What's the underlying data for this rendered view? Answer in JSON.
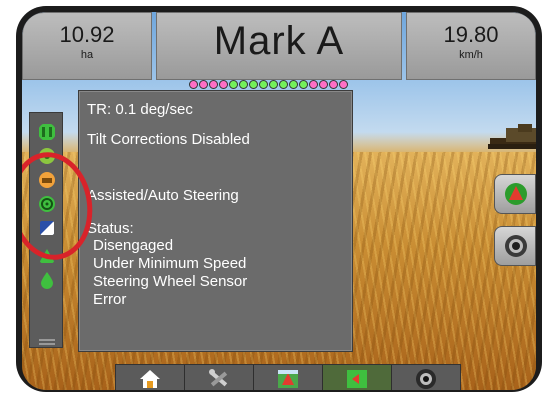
{
  "area": {
    "value": "10.92",
    "unit": "ha"
  },
  "mark": {
    "label": "Mark A"
  },
  "speed": {
    "value": "19.80",
    "unit": "km/h"
  },
  "lightbar": {
    "pink_dots": 4,
    "green_dots": 8,
    "pink_dots_right": 4
  },
  "panel": {
    "tr": "TR: 0.1 deg/sec",
    "tilt": "Tilt Corrections Disabled",
    "steering": "Assisted/Auto Steering",
    "status_label": "Status:",
    "status_lines": [
      "Disengaged",
      "Under Minimum Speed",
      "Steering Wheel Sensor",
      "Error"
    ]
  },
  "left_icons": [
    "boom-icon",
    "gps-icon",
    "tilt-icon",
    "steering-icon",
    "sensor-icon",
    "guidance-icon",
    "drop-icon"
  ],
  "right_buttons": [
    "guidance-mode-icon",
    "camera-icon"
  ],
  "bottom_bar": [
    "home-icon",
    "tools-icon",
    "guidance-view-icon",
    "map-view-icon",
    "camera-view-icon"
  ],
  "colors": {
    "annotation_ring": "#d8232a",
    "panel_bg": "#6b6b6b",
    "active_green": "#3fbf3f"
  }
}
